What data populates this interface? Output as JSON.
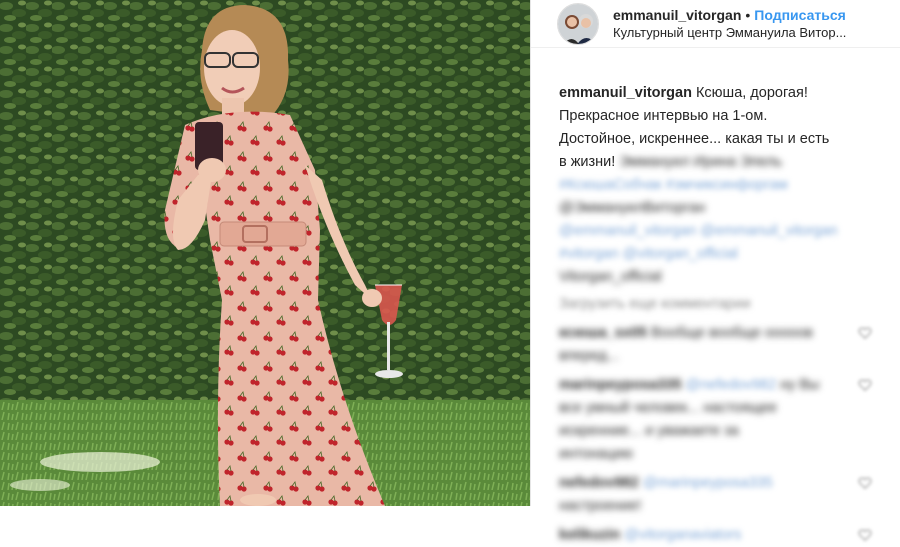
{
  "post": {
    "header": {
      "username": "emmanuil_vitorgan",
      "separator": "•",
      "follow_label": "Подписаться",
      "location": "Культурный центр Эммануила Витор..."
    },
    "caption": {
      "username": "emmanuil_vitorgan",
      "lines": [
        "Ксюша, дорогая!",
        "Прекрасное интервью на 1-ом.",
        "Достойное, искреннее... какая ты и есть",
        "в жизни!"
      ],
      "blurred_tail": "Эммануил Ирина Эпель",
      "blurred_tags": [
        "#КсюшаСобчак #эмчиксинфоргам",
        "@ЭммануилВиторган",
        "@emmanuil_vitorgan @emmanuil_vitorgan",
        "#vitorgan @vitorgan_official",
        "Vitorgan_official"
      ]
    },
    "load_more": "Загрузить еще комментарии",
    "comments": [
      {
        "user": "ксюша_sx05",
        "text": "Вообще вообще ооооов",
        "cont": "вперед..."
      },
      {
        "user": "marinpeyposa335",
        "mention": "@nefedov982",
        "text": "ну Вы",
        "cont": [
          "все умный человек... настоящее",
          "искренние... и уважаете за",
          "интонацию"
        ]
      },
      {
        "user": "nefedov982",
        "mention": "@marinpeyposa335",
        "text": "",
        "cont": "настроение!"
      },
      {
        "user": "kelikuzin",
        "mention": "@vitorganaviators",
        "text": "",
        "cont": ""
      }
    ]
  },
  "colors": {
    "link_blue": "#3897f0",
    "text": "#262626",
    "dress_pink": "#e9b8a6",
    "cherry": "#c0242b"
  },
  "photo": {
    "subject": "woman in pink cherry-print dress holding phone and wine glass on lawn"
  }
}
